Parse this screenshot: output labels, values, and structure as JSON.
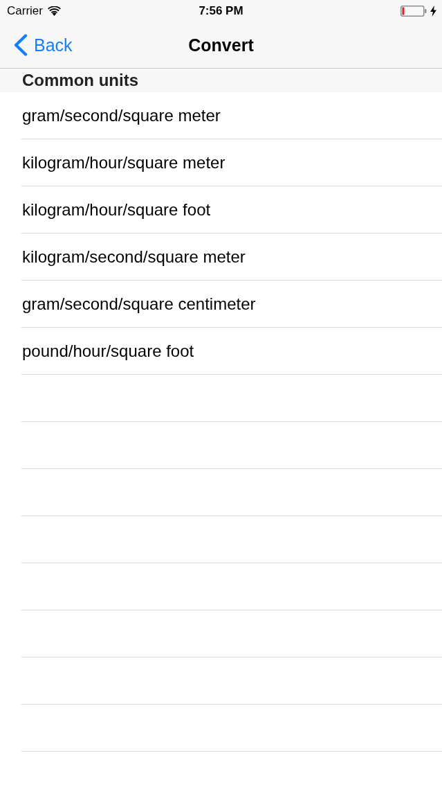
{
  "status_bar": {
    "carrier": "Carrier",
    "time": "7:56 PM"
  },
  "nav_bar": {
    "back": "Back",
    "title": "Convert"
  },
  "sections": [
    {
      "header": "Common units",
      "rows": [
        "gram/second/square meter",
        "kilogram/hour/square meter",
        "kilogram/hour/square foot",
        "kilogram/second/square meter",
        "gram/second/square centimeter",
        "pound/hour/square foot"
      ]
    }
  ]
}
